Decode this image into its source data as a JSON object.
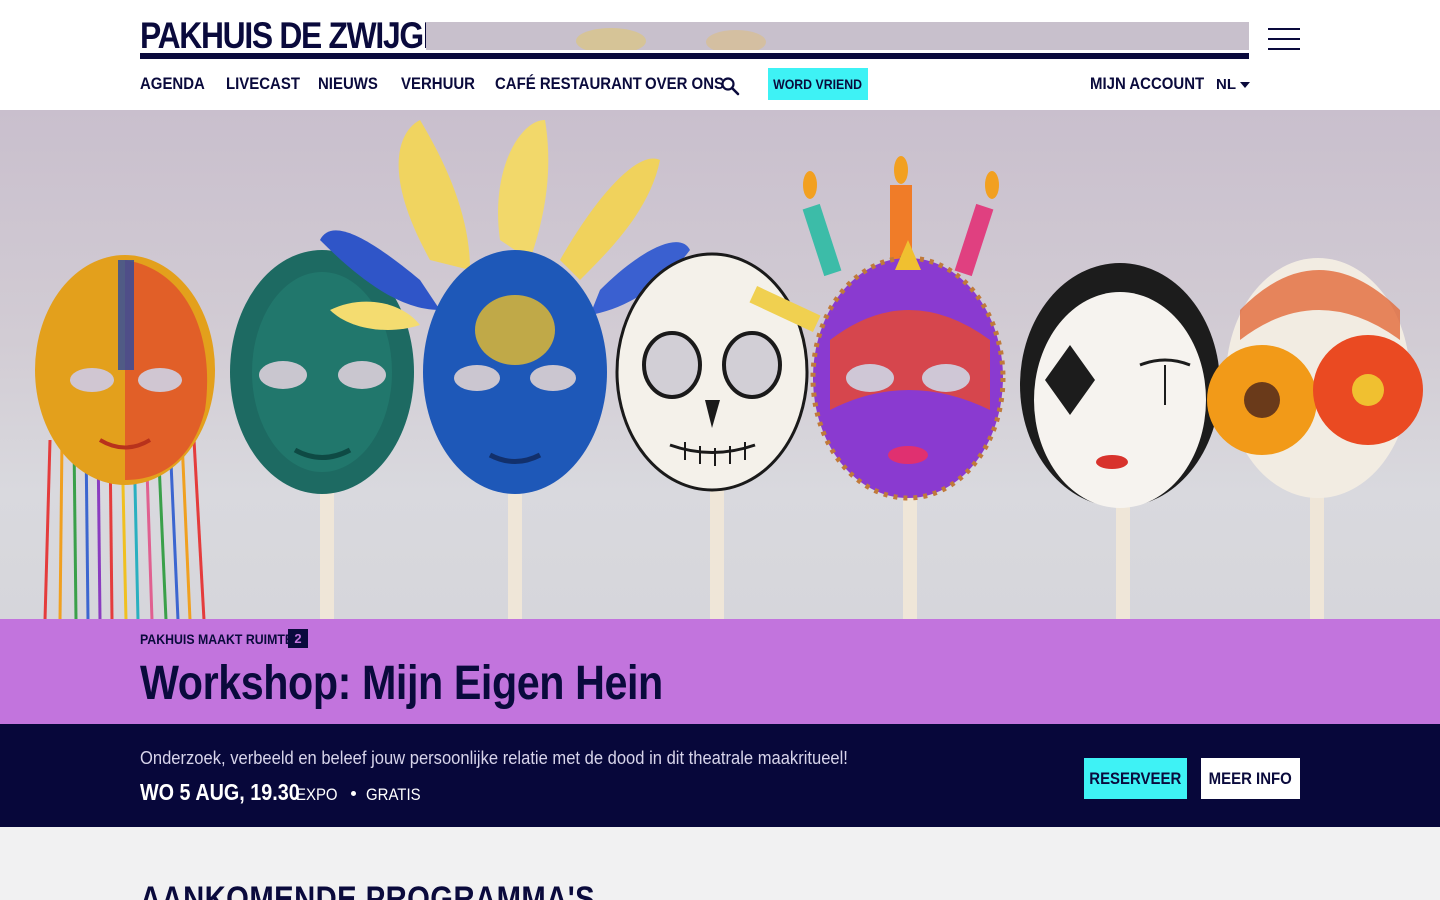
{
  "header": {
    "logo_text": "PAKHUIS DE ZWIJGER",
    "menu_icon": "hamburger-menu-icon",
    "nav": [
      {
        "label": "AGENDA"
      },
      {
        "label": "LIVECAST"
      },
      {
        "label": "NIEUWS"
      },
      {
        "label": "VERHUUR"
      },
      {
        "label": "CAFÉ RESTAURANT"
      },
      {
        "label": "OVER ONS"
      }
    ],
    "search_icon": "search-icon",
    "cta_label": "WORD VRIEND",
    "account_label": "MIJN ACCOUNT",
    "language": "NL"
  },
  "hero": {
    "image_subject": "row of painted masks on sticks"
  },
  "event": {
    "series_label": "PAKHUIS MAAKT RUIMTE",
    "series_number": "2",
    "title": "Workshop: Mijn Eigen Hein",
    "description": "Onderzoek, verbeeld en beleef jouw persoonlijke relatie met de dood in dit theatrale maakritueel!",
    "date": "WO 5 AUG, 19.30",
    "location": "EXPO",
    "price": "GRATIS",
    "reserve_label": "RESERVEER",
    "info_label": "MEER INFO"
  },
  "upcoming": {
    "heading": "AANKOMENDE PROGRAMMA'S"
  },
  "colors": {
    "navy": "#0a0a3c",
    "cyan": "#3ef2f5",
    "purple": "#c274dd",
    "dark_bar": "#07073a"
  }
}
